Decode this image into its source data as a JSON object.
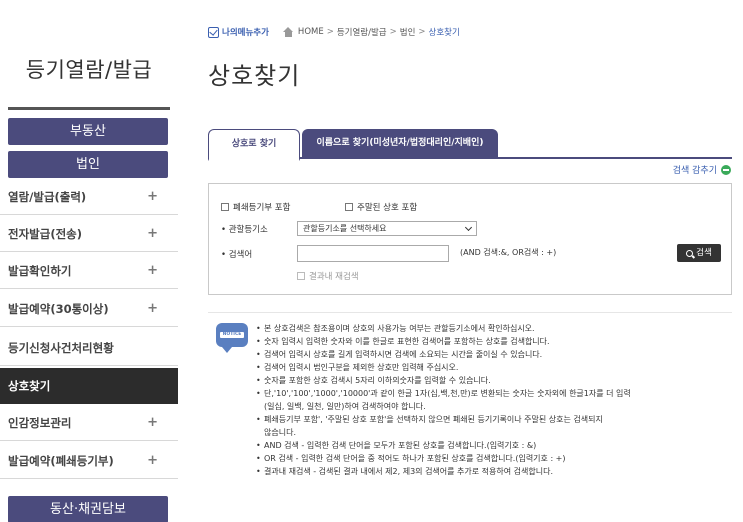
{
  "sidebar": {
    "title": "등기열람/발급",
    "categories": [
      "부동산",
      "법인",
      "동산·채권담보"
    ],
    "items": [
      {
        "label": "열람/발급(출력)",
        "plus": "+"
      },
      {
        "label": "전자발급(전송)",
        "plus": "+"
      },
      {
        "label": "발급확인하기",
        "plus": "+"
      },
      {
        "label": "발급예약(30통이상)",
        "plus": "+"
      },
      {
        "label": "등기신청사건처리현황",
        "plus": ""
      },
      {
        "label": "상호찾기",
        "plus": ""
      },
      {
        "label": "인감정보관리",
        "plus": "+"
      },
      {
        "label": "발급예약(폐쇄등기부)",
        "plus": "+"
      }
    ]
  },
  "breadcrumb": {
    "mymenu": "나의메뉴추가",
    "home": "HOME",
    "path1": "등기열람/발급",
    "path2": "법인",
    "current": "상호찾기",
    "sep": ">"
  },
  "page_title": "상호찾기",
  "tabs": [
    {
      "label": "상호로 찾기"
    },
    {
      "label": "이름으로 찾기(미성년자/법정대리인/지배인)"
    }
  ],
  "collapse_label": "검색 감추기",
  "search": {
    "opt_closed": "폐쇄등기부 포함",
    "opt_dormant": "주말된 상호 포함",
    "registry_label": "관할등기소",
    "registry_value": "관할등기소를 선택하세요",
    "keyword_label": "검색어",
    "keyword_value": "",
    "hint": "(AND 검색:&, OR검색 : +)",
    "button": "검색",
    "within": "결과내 재검색"
  },
  "notices": [
    "본 상호검색은 참조용이며 상호의 사용가능 여부는 관할등기소에서 확인하십시오.",
    "숫자 입력시 입력한 숫자와 이를 한글로 표현한 검색어를 포함하는 상호를 검색합니다.",
    "검색어 입력시 상호를 길게 입력하시면 검색에 소요되는 시간을 줄이실 수 있습니다.",
    "검색어 입력시 법인구분을 제외한 상호만 입력해 주십시오.",
    "숫자를 포함한 상호 검색시 5자리 이하의숫자를 입력할 수 있습니다.",
    "단,'10','100','1000','10000'과 같이 한글 1자(십,백,천,만)로 변환되는 숫자는 숫자외에 한글1자를 더 입력",
    "(일십, 일백, 일천, 일만)하여 검색하여야 합니다.",
    "폐쇄등기부 포함', '주말된 상호 포함'을 선택하지 않으면 폐쇄된 등기기록이나 주말된 상호는 검색되지",
    "않습니다.",
    "AND 검색 - 입력한 검색 단어을 모두가 포함된 상호를 검색합니다.(입력기호 : &)",
    "OR 검색 - 입력한 검색 단어을 중 적어도 하나가 포함된 상호를 검색합니다.(입력기호 : +)",
    "결과내 재검색 - 검색된 결과 내에서 제2, 제3의 검색어를 추가로 적용하여 검색합니다."
  ],
  "notice_icon_text": "NOTICE",
  "colors": {
    "accent": "#4b4b7d",
    "link": "#3a5fb0",
    "active_item": "#2c2c2c"
  }
}
